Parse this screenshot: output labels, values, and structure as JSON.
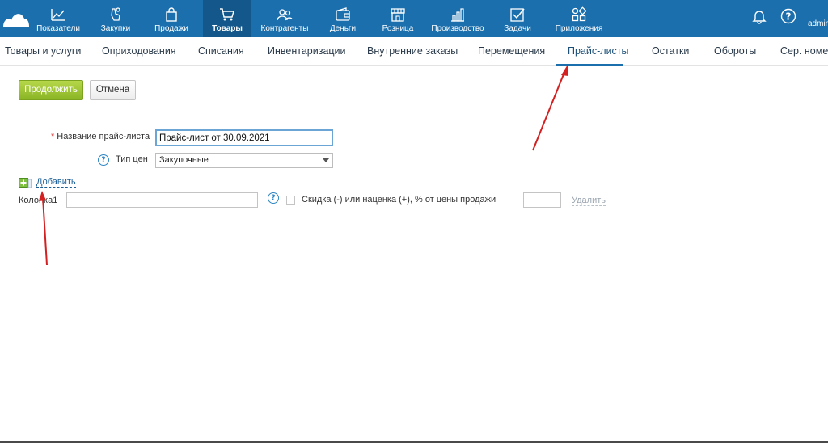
{
  "topnav": {
    "items": [
      {
        "label": "Показатели",
        "icon": "chart-line-icon"
      },
      {
        "label": "Закупки",
        "icon": "purchase-hand-icon"
      },
      {
        "label": "Продажи",
        "icon": "shopping-bag-icon"
      },
      {
        "label": "Товары",
        "icon": "cart-icon"
      },
      {
        "label": "Контрагенты",
        "icon": "people-icon"
      },
      {
        "label": "Деньги",
        "icon": "wallet-icon"
      },
      {
        "label": "Розница",
        "icon": "store-icon"
      },
      {
        "label": "Производство",
        "icon": "factory-icon"
      },
      {
        "label": "Задачи",
        "icon": "checkbox-task-icon"
      },
      {
        "label": "Приложения",
        "icon": "apps-grid-icon"
      }
    ],
    "active_index": 3,
    "bell_icon": "bell-icon",
    "help_icon": "help-circle-icon",
    "user_label": "admin"
  },
  "subnav": {
    "items": [
      "Товары и услуги",
      "Оприходования",
      "Списания",
      "Инвентаризации",
      "Внутренние заказы",
      "Перемещения",
      "Прайс-листы",
      "Остатки",
      "Обороты",
      "Сер. номера"
    ],
    "active_index": 6
  },
  "actions": {
    "continue_label": "Продолжить",
    "cancel_label": "Отмена"
  },
  "form": {
    "name_required_mark": "*",
    "name_label": "Название прайс-листа",
    "name_value": "Прайс-лист от 30.09.2021",
    "price_type_label": "Тип цен",
    "price_type_value": "Закупочные",
    "help_glyph": "?",
    "add_label": "Добавить",
    "column_label": "Колонка1",
    "discount_label": "Скидка (-) или наценка (+), % от цены продажи",
    "delete_label": "Удалить"
  },
  "colors": {
    "topbar": "#1b6fad",
    "topbar_active": "#14578a",
    "continue_button": "#8ab525",
    "link": "#1b5f96",
    "annotation_arrow": "#d32020"
  }
}
